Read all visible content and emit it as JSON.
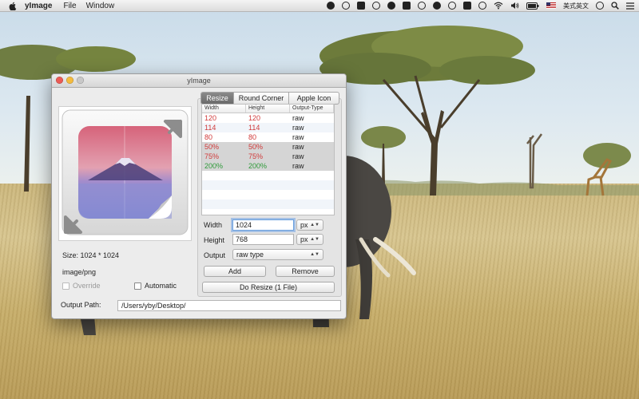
{
  "menubar": {
    "app_name": "yImage",
    "menus": [
      "File",
      "Window"
    ],
    "status_icons": [
      "qq-icon",
      "sync-icon",
      "lock-icon",
      "record-icon",
      "link-icon",
      "security-icon",
      "tools-icon",
      "bell-icon",
      "power-icon",
      "airplay-icon",
      "time-machine-icon",
      "wifi-icon",
      "volume-icon",
      "battery-icon",
      "flag-icon",
      "user-icon",
      "search-icon",
      "list-icon"
    ],
    "input_method": "美式英文"
  },
  "window": {
    "title": "yImage",
    "tabs": [
      {
        "label": "Resize",
        "active": true
      },
      {
        "label": "Round Corner",
        "active": false
      },
      {
        "label": "Apple Icon",
        "active": false
      }
    ],
    "table": {
      "columns": [
        "Width",
        "Height",
        "Output-Type"
      ],
      "rows": [
        {
          "width": "120",
          "height": "120",
          "type": "raw",
          "color": "red"
        },
        {
          "width": "114",
          "height": "114",
          "type": "raw",
          "color": "red"
        },
        {
          "width": "80",
          "height": "80",
          "type": "raw",
          "color": "red"
        },
        {
          "width": "50%",
          "height": "50%",
          "type": "raw",
          "color": "red"
        },
        {
          "width": "75%",
          "height": "75%",
          "type": "raw",
          "color": "red"
        },
        {
          "width": "200%",
          "height": "200%",
          "type": "raw",
          "color": "green"
        }
      ]
    },
    "form": {
      "width_label": "Width",
      "width_value": "1024",
      "width_unit": "px",
      "height_label": "Height",
      "height_value": "768",
      "height_unit": "px",
      "output_label": "Output",
      "output_value": "raw type"
    },
    "buttons": {
      "add": "Add",
      "remove": "Remove",
      "do_resize": "Do Resize (1 File)"
    },
    "info": {
      "size": "Size: 1024 * 1024",
      "mime": "image/png"
    },
    "checkboxes": {
      "override": "Override",
      "automatic": "Automatic"
    },
    "output": {
      "label": "Output Path:",
      "path": "/Users/yby/Desktop/"
    }
  },
  "colors": {
    "red_value": "#d03a3a",
    "green_value": "#2f9a3a",
    "selected_row": "#d5d5d5",
    "focus_ring": "#6aa0df"
  }
}
